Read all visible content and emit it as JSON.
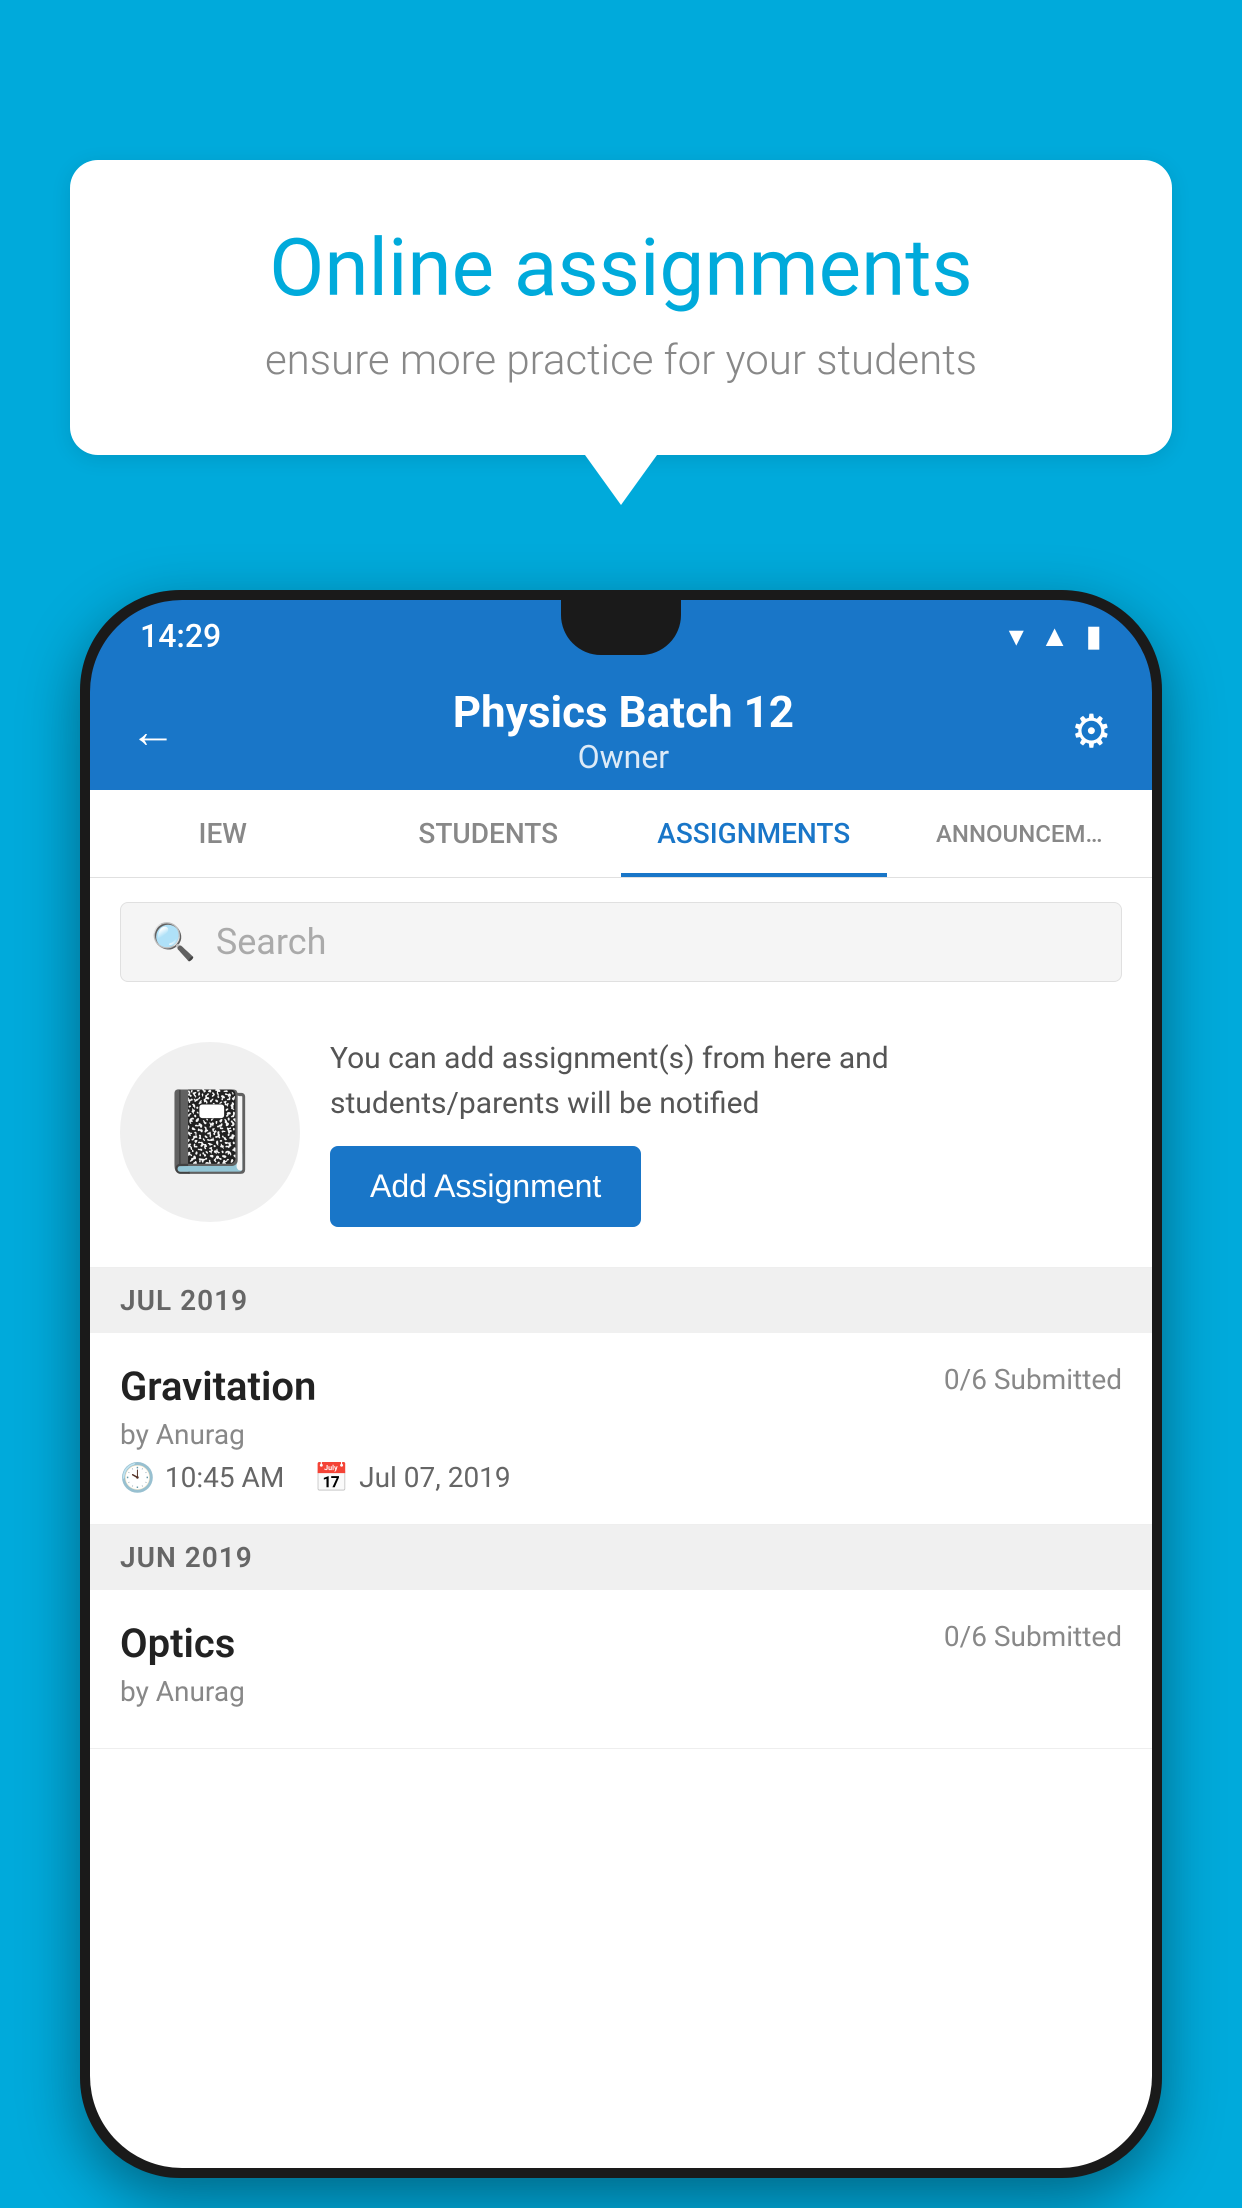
{
  "background_color": "#00AADB",
  "bubble": {
    "title": "Online assignments",
    "subtitle": "ensure more practice for your students"
  },
  "status_bar": {
    "time": "14:29",
    "icons": [
      "wifi",
      "signal",
      "battery"
    ]
  },
  "app_bar": {
    "title": "Physics Batch 12",
    "subtitle": "Owner",
    "back_label": "←",
    "settings_label": "⚙"
  },
  "tabs": [
    {
      "label": "IEW",
      "active": false
    },
    {
      "label": "STUDENTS",
      "active": false
    },
    {
      "label": "ASSIGNMENTS",
      "active": true
    },
    {
      "label": "ANNOUNCEM…",
      "active": false
    }
  ],
  "search": {
    "placeholder": "Search"
  },
  "promo": {
    "description": "You can add assignment(s) from here and students/parents will be notified",
    "button_label": "Add Assignment"
  },
  "sections": [
    {
      "month_label": "JUL 2019",
      "assignments": [
        {
          "name": "Gravitation",
          "submitted": "0/6 Submitted",
          "by": "by Anurag",
          "time": "10:45 AM",
          "date": "Jul 07, 2019"
        }
      ]
    },
    {
      "month_label": "JUN 2019",
      "assignments": [
        {
          "name": "Optics",
          "submitted": "0/6 Submitted",
          "by": "by Anurag",
          "time": "",
          "date": ""
        }
      ]
    }
  ]
}
